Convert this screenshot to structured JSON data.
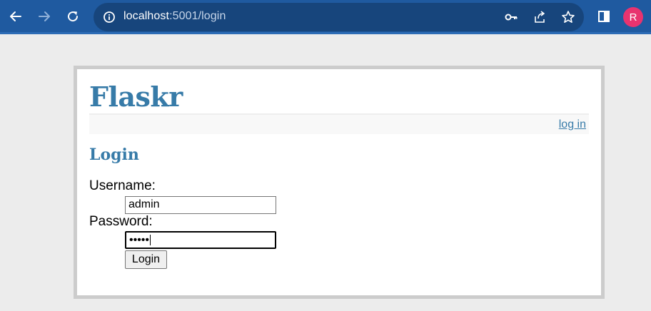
{
  "browser": {
    "url_host": "localhost",
    "url_rest": ":5001/login",
    "profile_initial": "R",
    "colors": {
      "toolbar": "#1f5aa0",
      "omnibox": "#17457c",
      "avatar": "#e8336f"
    },
    "icons": [
      "back-arrow-icon",
      "forward-arrow-icon",
      "reload-icon",
      "info-icon",
      "key-icon",
      "share-icon",
      "star-icon",
      "side-panel-icon"
    ]
  },
  "app": {
    "title": "Flaskr",
    "nav_login": "log in",
    "accent": "#377ba8"
  },
  "form": {
    "heading": "Login",
    "username_label": "Username:",
    "username_value": "admin",
    "password_label": "Password:",
    "password_masked": "•••••",
    "submit_label": "Login"
  }
}
